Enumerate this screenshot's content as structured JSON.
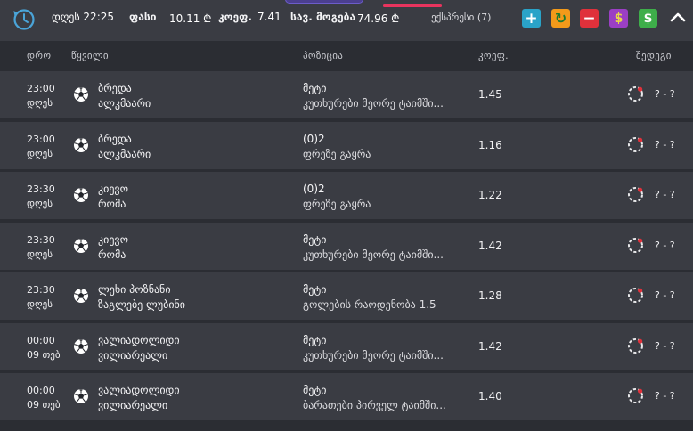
{
  "topbar": {
    "day_label": "დღეს 22:25",
    "price_label": "ფასი",
    "price_value": "10.11 ₾",
    "coef_label": "კოეფ.",
    "coef_value": "7.41",
    "win_label": "სავ. მოგება",
    "win_value": "74.96 ₾",
    "express_label": "ექსპრესი (7)",
    "buttons": [
      {
        "name": "add-button",
        "symbol": "+",
        "color": "#2aa3c8"
      },
      {
        "name": "refresh-button",
        "symbol": "↻",
        "color": "#f39a1a"
      },
      {
        "name": "remove-button",
        "symbol": "−",
        "color": "#e0313b"
      },
      {
        "name": "auto-button",
        "symbol": "$",
        "color": "#9b3fc4"
      },
      {
        "name": "cash-button",
        "symbol": "$",
        "color": "#3eae4a"
      }
    ]
  },
  "columns": {
    "time": "დრო",
    "pair": "წყვილი",
    "position": "პოზიცია",
    "coef": "კოეფ.",
    "result": "შედეგი"
  },
  "rows": [
    {
      "time": "23:00",
      "day": "დღეს",
      "team1": "ბრედა",
      "team2": "ალკმაარი",
      "pos": "მეტი",
      "pos_sub": "კუთხურები მეორე ტაიმში...",
      "coef": "1.45",
      "result": "? - ?"
    },
    {
      "time": "23:00",
      "day": "დღეს",
      "team1": "ბრედა",
      "team2": "ალკმაარი",
      "pos": "(0)2",
      "pos_sub": "ფრეზე გაყრა",
      "coef": "1.16",
      "result": "? - ?"
    },
    {
      "time": "23:30",
      "day": "დღეს",
      "team1": "კიევო",
      "team2": "რომა",
      "pos": "(0)2",
      "pos_sub": "ფრეზე გაყრა",
      "coef": "1.22",
      "result": "? - ?"
    },
    {
      "time": "23:30",
      "day": "დღეს",
      "team1": "კიევო",
      "team2": "რომა",
      "pos": "მეტი",
      "pos_sub": "კუთხურები მეორე ტაიმში...",
      "coef": "1.42",
      "result": "? - ?"
    },
    {
      "time": "23:30",
      "day": "დღეს",
      "team1": "ლეხი პოზნანი",
      "team2": "ზაგლებე ლუბინი",
      "pos": "მეტი",
      "pos_sub": "გოლების რაოდენობა 1.5",
      "coef": "1.28",
      "result": "? - ?"
    },
    {
      "time": "00:00",
      "day": "09 თებ",
      "team1": "ვალიადოლიდი",
      "team2": "ვილიარეალი",
      "pos": "მეტი",
      "pos_sub": "კუთხურები მეორე ტაიმში...",
      "coef": "1.42",
      "result": "? - ?"
    },
    {
      "time": "00:00",
      "day": "09 თებ",
      "team1": "ვალიადოლიდი",
      "team2": "ვილიარეალი",
      "pos": "მეტი",
      "pos_sub": "ბარათები პირველ ტაიმში...",
      "coef": "1.40",
      "result": "? - ?"
    }
  ]
}
